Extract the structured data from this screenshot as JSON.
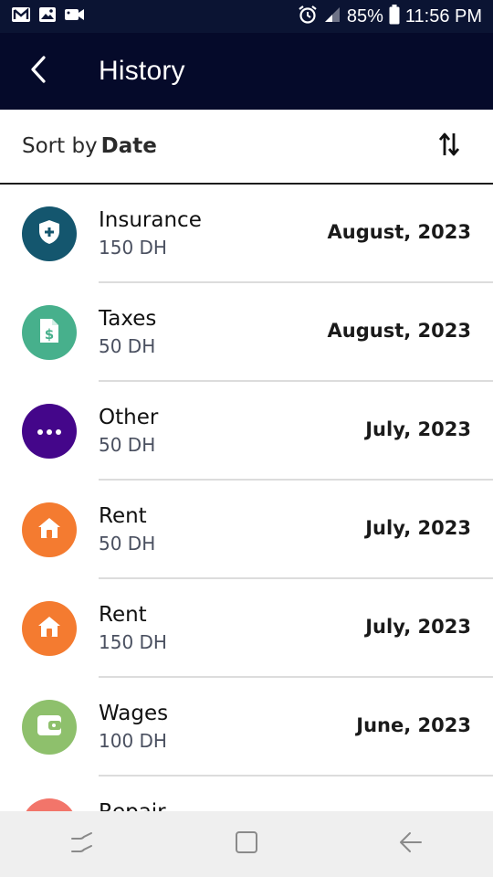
{
  "status_bar": {
    "battery": "85%",
    "time": "11:56 PM",
    "icons": [
      "gmail-icon",
      "gallery-icon",
      "video-icon",
      "alarm-icon",
      "signal-icon",
      "battery-icon"
    ]
  },
  "app_bar": {
    "title": "History",
    "back_icon": "back-arrow-icon"
  },
  "sort": {
    "prefix": "Sort by",
    "value": "Date",
    "toggle_icon": "sort-arrows-icon"
  },
  "items": [
    {
      "name": "Insurance",
      "amount": "150 DH",
      "date": "August, 2023",
      "icon": "shield-plus-icon",
      "color": "#14566e"
    },
    {
      "name": "Taxes",
      "amount": "50 DH",
      "date": "August, 2023",
      "icon": "document-dollar-icon",
      "color": "#47b08c"
    },
    {
      "name": "Other",
      "amount": "50 DH",
      "date": "July, 2023",
      "icon": "more-dots-icon",
      "color": "#44068a"
    },
    {
      "name": "Rent",
      "amount": "50 DH",
      "date": "July, 2023",
      "icon": "house-icon",
      "color": "#f47b30"
    },
    {
      "name": "Rent",
      "amount": "150 DH",
      "date": "July, 2023",
      "icon": "house-icon",
      "color": "#f47b30"
    },
    {
      "name": "Wages",
      "amount": "100 DH",
      "date": "June, 2023",
      "icon": "wallet-icon",
      "color": "#8ec06c"
    },
    {
      "name": "Repair",
      "amount": "",
      "date": "",
      "icon": "repair-icon",
      "color": "#f2756a"
    }
  ],
  "nav_bar": {
    "icons": [
      "recent-apps-icon",
      "home-icon",
      "back-icon"
    ]
  }
}
